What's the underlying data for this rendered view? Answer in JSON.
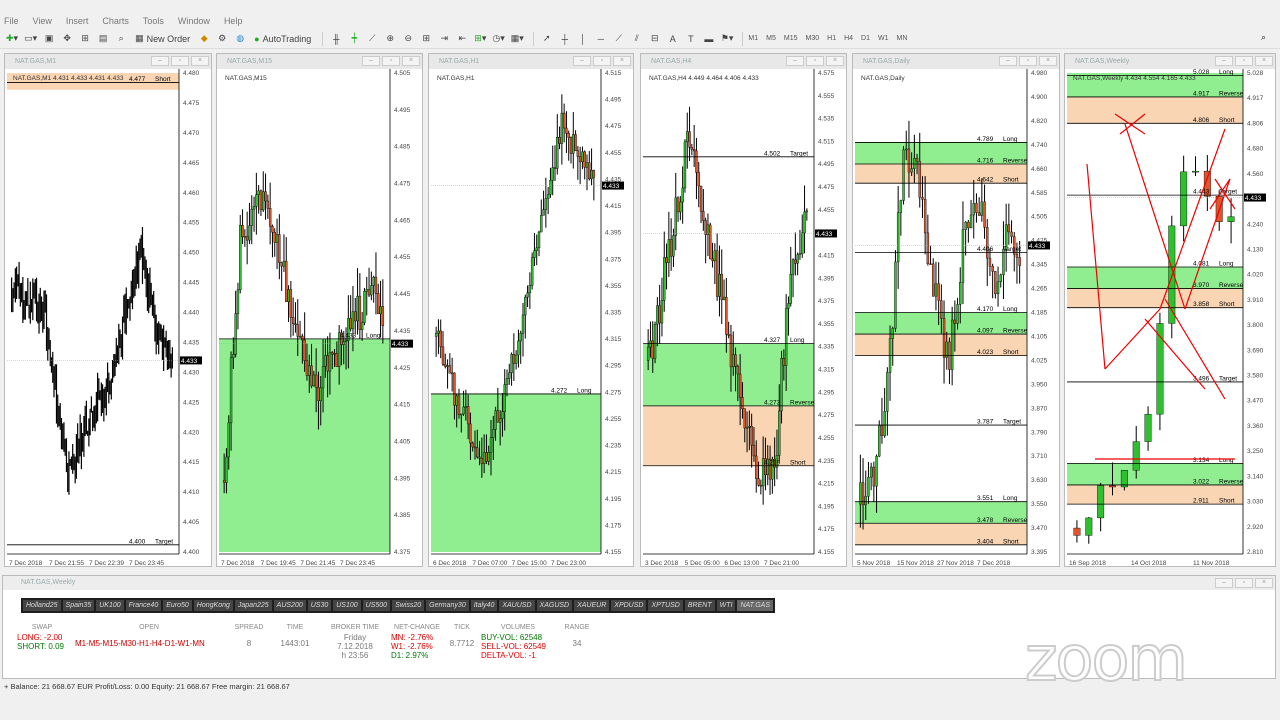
{
  "menu": [
    "File",
    "View",
    "Insert",
    "Charts",
    "Tools",
    "Window",
    "Help"
  ],
  "toolbar": {
    "new_order": "New Order",
    "auto_trading": "AutoTrading",
    "timeframes": [
      "M1",
      "M5",
      "M15",
      "M30",
      "H1",
      "H4",
      "D1",
      "W1",
      "MN"
    ]
  },
  "charts": [
    {
      "title": "NAT.GAS,M1",
      "legend": "NAT.GAS,M1  4.431 4.433 4.431 4.433",
      "price_ticks": [
        "4.480",
        "4.475",
        "4.470",
        "4.465",
        "4.460",
        "4.455",
        "4.450",
        "4.445",
        "4.440",
        "4.435",
        "4.430",
        "4.425",
        "4.420",
        "4.415",
        "4.410",
        "4.405",
        "4.400"
      ],
      "time_ticks": [
        "7 Dec 2018",
        "7 Dec 21:55",
        "7 Dec 22:39",
        "7 Dec 23:45"
      ],
      "zones": [
        {
          "y0": 0.0,
          "y1": 0.035,
          "color": "#f9d5b4"
        }
      ],
      "lines": [
        {
          "label": "4.477",
          "tag": "Short",
          "y": 0.02
        },
        {
          "label": "4.400",
          "tag": "Target",
          "y": 0.985
        }
      ],
      "price": "4.433",
      "price_y": 0.6,
      "candles": "m1"
    },
    {
      "title": "NAT.GAS,M15",
      "legend": "NAT.GAS,M15",
      "price_ticks": [
        "4.505",
        "4.495",
        "4.485",
        "4.475",
        "4.465",
        "4.455",
        "4.445",
        "4.435",
        "4.425",
        "4.415",
        "4.405",
        "4.395",
        "4.385",
        "4.375"
      ],
      "time_ticks": [
        "7 Dec 2018",
        "7 Dec 19:45",
        "7 Dec 21:45",
        "7 Dec 23:45"
      ],
      "zones": [
        {
          "y0": 0.555,
          "y1": 1.0,
          "color": "#90ee90"
        }
      ],
      "lines": [
        {
          "label": "4.433",
          "tag": "Long",
          "y": 0.555
        }
      ],
      "price": "4.433",
      "price_y": 0.565,
      "candles": "m15"
    },
    {
      "title": "NAT.GAS,H1",
      "legend": "NAT.GAS,H1",
      "price_ticks": [
        "4.515",
        "4.495",
        "4.475",
        "4.455",
        "4.435",
        "4.415",
        "4.395",
        "4.375",
        "4.355",
        "4.335",
        "4.315",
        "4.295",
        "4.275",
        "4.255",
        "4.235",
        "4.215",
        "4.195",
        "4.175",
        "4.155"
      ],
      "time_ticks": [
        "6 Dec 2018",
        "7 Dec 07:00",
        "7 Dec 15:00",
        "7 Dec 23:00"
      ],
      "zones": [
        {
          "y0": 0.67,
          "y1": 1.0,
          "color": "#90ee90"
        }
      ],
      "lines": [
        {
          "label": "4.272",
          "tag": "Long",
          "y": 0.67
        }
      ],
      "price": "4.433",
      "price_y": 0.235,
      "candles": "h1"
    },
    {
      "title": "NAT.GAS,H4",
      "legend": "NAT.GAS,H4  4.449 4.464 4.406 4.433",
      "price_ticks": [
        "4.575",
        "4.555",
        "4.535",
        "4.515",
        "4.495",
        "4.475",
        "4.455",
        "4.435",
        "4.415",
        "4.395",
        "4.375",
        "4.355",
        "4.335",
        "4.315",
        "4.295",
        "4.275",
        "4.255",
        "4.235",
        "4.215",
        "4.195",
        "4.175",
        "4.155"
      ],
      "time_ticks": [
        "3 Dec 2018",
        "5 Dec 05:00",
        "6 Dec 13:00",
        "7 Dec 21:00"
      ],
      "zones": [
        {
          "y0": 0.565,
          "y1": 0.695,
          "color": "#90ee90"
        },
        {
          "y0": 0.695,
          "y1": 0.82,
          "color": "#f9d5b4"
        }
      ],
      "lines": [
        {
          "label": "4.502",
          "tag": "Target",
          "y": 0.175
        },
        {
          "label": "4.327",
          "tag": "Long",
          "y": 0.565
        },
        {
          "label": "4.273",
          "tag": "Reverse",
          "y": 0.695
        },
        {
          "label": "4.219",
          "tag": "Short",
          "y": 0.82
        }
      ],
      "price": "4.433",
      "price_y": 0.335,
      "candles": "h4"
    },
    {
      "title": "NAT.GAS,Daily",
      "legend": "NAT.GAS,Daily",
      "price_ticks": [
        "4.980",
        "4.900",
        "4.820",
        "4.740",
        "4.660",
        "4.585",
        "4.505",
        "4.425",
        "4.345",
        "4.265",
        "4.185",
        "4.105",
        "4.025",
        "3.950",
        "3.870",
        "3.790",
        "3.710",
        "3.630",
        "3.550",
        "3.470",
        "3.395"
      ],
      "time_ticks": [
        "5 Nov 2018",
        "15 Nov 2018",
        "27 Nov 2018",
        "7 Dec 2018"
      ],
      "zones": [
        {
          "y0": 0.145,
          "y1": 0.19,
          "color": "#90ee90"
        },
        {
          "y0": 0.19,
          "y1": 0.23,
          "color": "#f9d5b4"
        },
        {
          "y0": 0.5,
          "y1": 0.545,
          "color": "#90ee90"
        },
        {
          "y0": 0.545,
          "y1": 0.59,
          "color": "#f9d5b4"
        },
        {
          "y0": 0.895,
          "y1": 0.94,
          "color": "#90ee90"
        },
        {
          "y0": 0.94,
          "y1": 0.985,
          "color": "#f9d5b4"
        }
      ],
      "lines": [
        {
          "label": "4.789",
          "tag": "Long",
          "y": 0.145
        },
        {
          "label": "4.716",
          "tag": "Reverse",
          "y": 0.19
        },
        {
          "label": "4.642",
          "tag": "Short",
          "y": 0.23
        },
        {
          "label": "4.406",
          "tag": "Target",
          "y": 0.375
        },
        {
          "label": "4.170",
          "tag": "Long",
          "y": 0.5
        },
        {
          "label": "4.097",
          "tag": "Reverse",
          "y": 0.545
        },
        {
          "label": "4.023",
          "tag": "Short",
          "y": 0.59
        },
        {
          "label": "3.787",
          "tag": "Target",
          "y": 0.735
        },
        {
          "label": "3.551",
          "tag": "Long",
          "y": 0.895
        },
        {
          "label": "3.478",
          "tag": "Reverse",
          "y": 0.94
        },
        {
          "label": "3.404",
          "tag": "Short",
          "y": 0.985
        }
      ],
      "price": "4.433",
      "price_y": 0.36,
      "candles": "d1"
    },
    {
      "title": "NAT.GAS,Weekly",
      "legend": "NAT.GAS,Weekly  4.434 4.554 4.165 4.433",
      "price_ticks": [
        "5.028",
        "4.917",
        "4.806",
        "4.680",
        "4.560",
        "4.450",
        "4.240",
        "4.130",
        "4.020",
        "3.910",
        "3.800",
        "3.690",
        "3.580",
        "3.470",
        "3.360",
        "3.250",
        "3.140",
        "3.030",
        "2.920",
        "2.810"
      ],
      "time_ticks": [
        "16 Sep 2018",
        "14 Oct 2018",
        "11 Nov 2018"
      ],
      "zones": [
        {
          "y0": 0.0,
          "y1": 0.05,
          "color": "#90ee90"
        },
        {
          "y0": 0.05,
          "y1": 0.105,
          "color": "#f9d5b4"
        },
        {
          "y0": 0.405,
          "y1": 0.45,
          "color": "#90ee90"
        },
        {
          "y0": 0.45,
          "y1": 0.49,
          "color": "#f9d5b4"
        },
        {
          "y0": 0.815,
          "y1": 0.86,
          "color": "#90ee90"
        },
        {
          "y0": 0.86,
          "y1": 0.9,
          "color": "#f9d5b4"
        }
      ],
      "lines": [
        {
          "label": "5.028",
          "tag": "Long",
          "y": 0.005
        },
        {
          "label": "4.917",
          "tag": "Reverse",
          "y": 0.05
        },
        {
          "label": "4.806",
          "tag": "Short",
          "y": 0.105
        },
        {
          "label": "4.443",
          "tag": "Target",
          "y": 0.255
        },
        {
          "label": "4.081",
          "tag": "Long",
          "y": 0.405
        },
        {
          "label": "3.970",
          "tag": "Reverse",
          "y": 0.45
        },
        {
          "label": "3.858",
          "tag": "Short",
          "y": 0.49
        },
        {
          "label": "3.496",
          "tag": "Target",
          "y": 0.645
        },
        {
          "label": "3.134",
          "tag": "Long",
          "y": 0.815
        },
        {
          "label": "3.022",
          "tag": "Reverse",
          "y": 0.86
        },
        {
          "label": "2.911",
          "tag": "Short",
          "y": 0.9
        }
      ],
      "price": "4.433",
      "price_y": 0.26,
      "candles": "w1"
    }
  ],
  "terminal": {
    "title": "NAT.GAS,Weekly",
    "symbols": [
      "Holland25",
      "Spain35",
      "UK100",
      "France40",
      "Euro50",
      "HongKong",
      "Japan225",
      "AUS200",
      "US30",
      "US100",
      "US500",
      "Swiss20",
      "Germany30",
      "Italy40",
      "XAUUSD",
      "XAGUSD",
      "XAUEUR",
      "XPDUSD",
      "XPTUSD",
      "BRENT",
      "WTI",
      "NAT.GAS"
    ],
    "active_symbol": "NAT.GAS",
    "swap": {
      "h": "SWAP",
      "long": "LONG: -2.00",
      "short": "SHORT: 0.09"
    },
    "open": {
      "h": "OPEN",
      "v": "M1-M5-M15-M30-H1-H4-D1-W1-MN"
    },
    "spread": {
      "h": "SPREAD",
      "v": "8"
    },
    "time": {
      "h": "TIME",
      "v": "1443:01"
    },
    "broker": {
      "h": "BROKER TIME",
      "l1": "Friday",
      "l2": "7.12.2018",
      "l3": "h 23:56"
    },
    "netchange": {
      "h": "NET-CHANGE",
      "mn": "MN: -2.76%",
      "w1": "W1: -2.76%",
      "d1": "D1: 2.97%"
    },
    "tick": {
      "h": "TICK",
      "v": "8.7712"
    },
    "volumes": {
      "h": "VOLUMES",
      "buy": "BUY-VOL: 62548",
      "sell": "SELL-VOL: 62549",
      "delta": "DELTA-VOL: -1"
    },
    "range": {
      "h": "RANGE",
      "v": "34"
    }
  },
  "status": "Balance: 21 668.67 EUR  Profit/Loss: 0.00  Equity: 21 668.67  Free margin: 21 668.67",
  "watermark": "zoom"
}
